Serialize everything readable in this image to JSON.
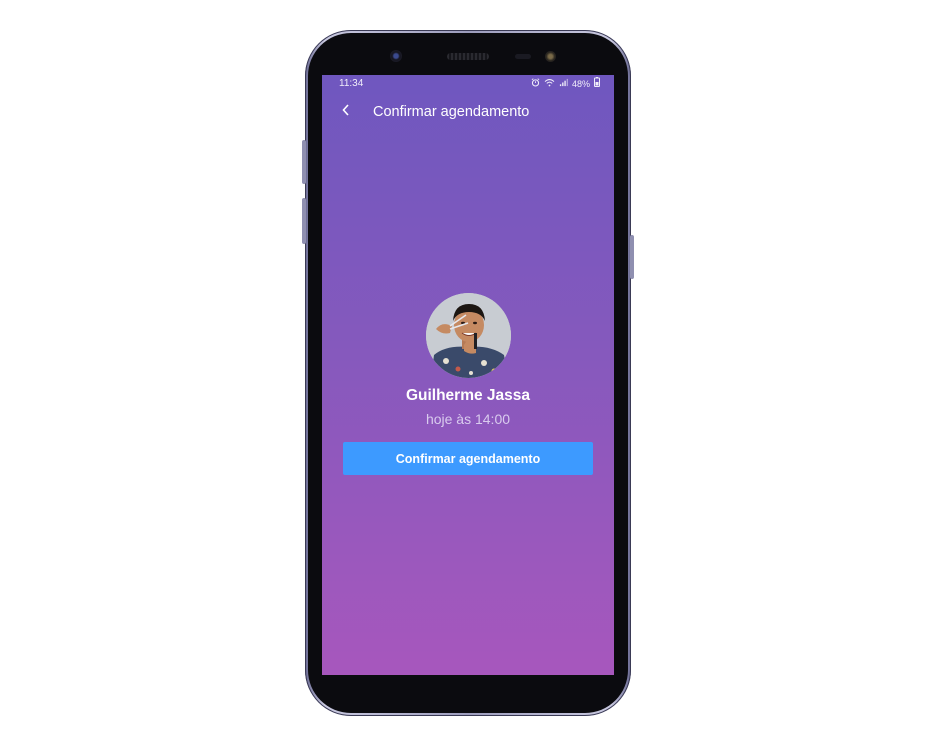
{
  "status_bar": {
    "time": "11:34",
    "battery": "48%",
    "icons": [
      "alarm-icon",
      "wifi-icon",
      "signal-icon",
      "battery-icon"
    ]
  },
  "app_bar": {
    "back_icon": "chevron-left-icon",
    "title": "Confirmar agendamento"
  },
  "profile": {
    "name": "Guilherme Jassa",
    "schedule": "hoje às 14:00"
  },
  "actions": {
    "confirm_label": "Confirmar agendamento"
  },
  "colors": {
    "gradient_top": "#6f57bf",
    "gradient_bottom": "#a757bd",
    "button": "#3d9aff",
    "subtitle": "#d9cbee"
  }
}
